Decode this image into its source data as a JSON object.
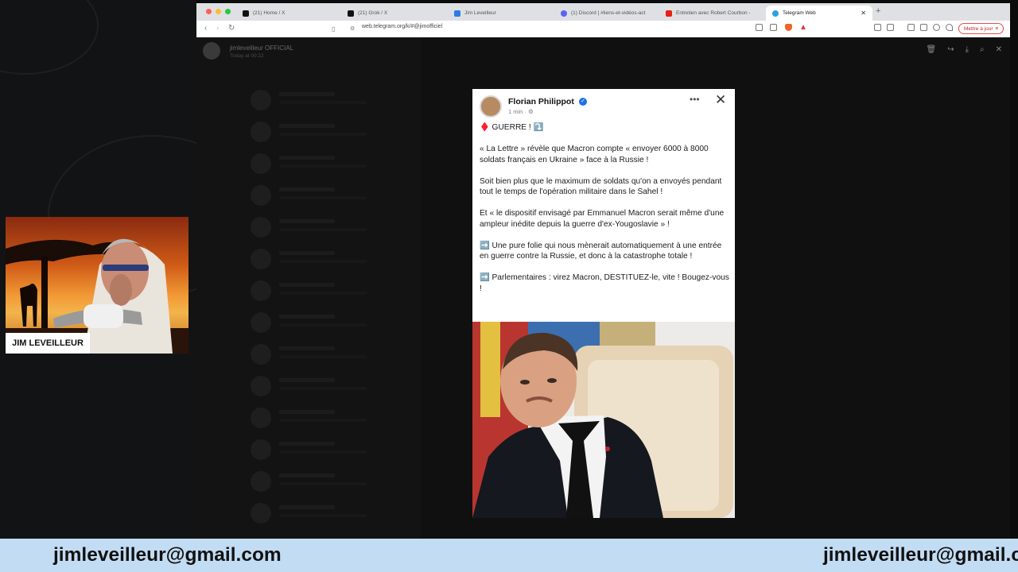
{
  "browser": {
    "tabs": [
      {
        "title": "(21) Home / X",
        "icon": "x-icon"
      },
      {
        "title": "(21) Grok / X",
        "icon": "x-icon"
      },
      {
        "title": "Jim Leveilleur",
        "icon": "page-icon"
      },
      {
        "title": "(1) Discord | #liens-et-vidéos-act",
        "icon": "discord-icon"
      },
      {
        "title": "Entretien avec Robert Courbon -",
        "icon": "youtube-icon"
      },
      {
        "title": "Telegram Web",
        "icon": "telegram-icon"
      }
    ],
    "active_tab": 5,
    "url": "web.telegram.org/k/#@jimofficiel",
    "update_button": "Mettre à jour",
    "colors": {
      "traffic_red": "#fe5f57",
      "traffic_yellow": "#febc2e",
      "traffic_green": "#28c840"
    }
  },
  "telegram": {
    "channel_name": "jimleveilleur OFFICIAL",
    "channel_time": "Today at 00:22",
    "viewer_icons": [
      "delete-icon",
      "forward-icon",
      "download-icon",
      "zoom-icon",
      "close-icon"
    ]
  },
  "post": {
    "author": "Florian Philippot",
    "time": "1 min · ⚙",
    "paragraphs": [
      "♦️ GUERRE ! ⤵️",
      "« La Lettre » révèle que Macron compte « envoyer 6000 à 8000 soldats français en Ukraine » face à la Russie !",
      "Soit bien plus que le maximum de soldats qu'on a envoyés pendant tout le temps de l'opération militaire dans le Sahel !",
      "Et « le dispositif envisagé par Emmanuel Macron serait même d'une ampleur inédite depuis la guerre d'ex-Yougoslavie » !",
      "➡️ Une pure folie qui nous mènerait automatiquement à une entrée en guerre contre la Russie, et donc à la catastrophe totale !",
      "➡️ Parlementaires : virez Macron, DESTITUEZ-le, vite ! Bougez-vous !"
    ]
  },
  "webcam": {
    "label": "JIM LEVEILLEUR"
  },
  "banner": {
    "email": "jimleveilleur@gmail.com"
  }
}
